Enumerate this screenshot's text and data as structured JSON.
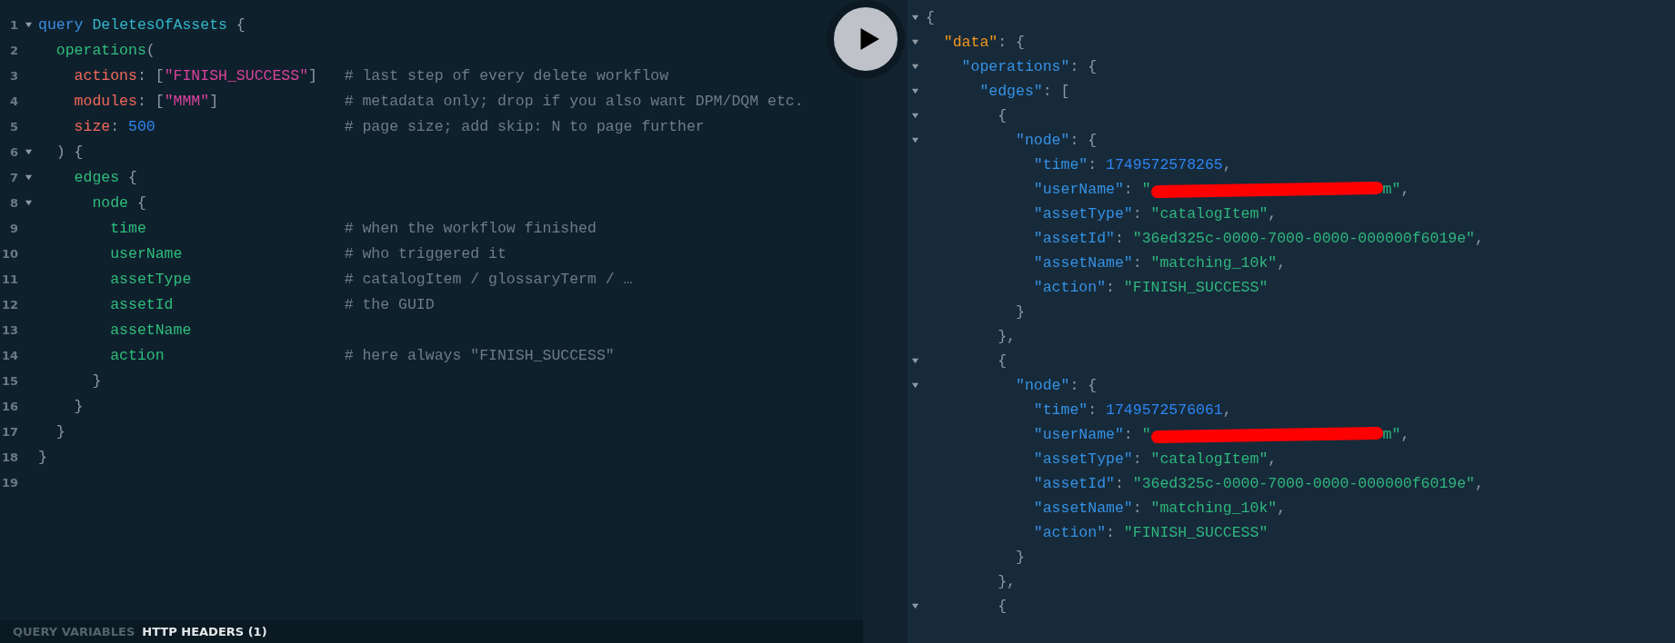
{
  "editor": {
    "lines": [
      {
        "number": "1",
        "foldable": true,
        "code": [
          {
            "kind": "keyword",
            "text": "query "
          },
          {
            "kind": "name",
            "text": "DeletesOfAssets"
          },
          {
            "kind": "punct",
            "text": " {"
          }
        ]
      },
      {
        "number": "2",
        "foldable": false,
        "code": [
          {
            "kind": "field",
            "text": "  operations"
          },
          {
            "kind": "punct",
            "text": "("
          }
        ]
      },
      {
        "number": "3",
        "foldable": false,
        "code": [
          {
            "kind": "arg",
            "text": "    actions"
          },
          {
            "kind": "punct",
            "text": ": ["
          },
          {
            "kind": "string",
            "text": "\"FINISH_SUCCESS\""
          },
          {
            "kind": "punct",
            "text": "]"
          }
        ],
        "comment": "# last step of every delete workflow"
      },
      {
        "number": "4",
        "foldable": false,
        "code": [
          {
            "kind": "arg",
            "text": "    modules"
          },
          {
            "kind": "punct",
            "text": ": ["
          },
          {
            "kind": "string",
            "text": "\"MMM\""
          },
          {
            "kind": "punct",
            "text": "]"
          }
        ],
        "comment": "# metadata only; drop if you also want DPM/DQM etc."
      },
      {
        "number": "5",
        "foldable": false,
        "code": [
          {
            "kind": "arg",
            "text": "    size"
          },
          {
            "kind": "punct",
            "text": ": "
          },
          {
            "kind": "number",
            "text": "500"
          }
        ],
        "comment": "# page size; add skip: N to page further"
      },
      {
        "number": "6",
        "foldable": true,
        "code": [
          {
            "kind": "punct",
            "text": "  ) {"
          }
        ]
      },
      {
        "number": "7",
        "foldable": true,
        "code": [
          {
            "kind": "field",
            "text": "    edges"
          },
          {
            "kind": "punct",
            "text": " {"
          }
        ]
      },
      {
        "number": "8",
        "foldable": true,
        "code": [
          {
            "kind": "field",
            "text": "      node"
          },
          {
            "kind": "punct",
            "text": " {"
          }
        ]
      },
      {
        "number": "9",
        "foldable": false,
        "code": [
          {
            "kind": "field",
            "text": "        time"
          }
        ],
        "comment": "# when the workflow finished"
      },
      {
        "number": "10",
        "foldable": false,
        "code": [
          {
            "kind": "field",
            "text": "        userName"
          }
        ],
        "comment": "# who triggered it"
      },
      {
        "number": "11",
        "foldable": false,
        "code": [
          {
            "kind": "field",
            "text": "        assetType"
          }
        ],
        "comment": "# catalogItem / glossaryTerm / …"
      },
      {
        "number": "12",
        "foldable": false,
        "code": [
          {
            "kind": "field",
            "text": "        assetId"
          }
        ],
        "comment": "# the GUID"
      },
      {
        "number": "13",
        "foldable": false,
        "code": [
          {
            "kind": "field",
            "text": "        assetName"
          }
        ]
      },
      {
        "number": "14",
        "foldable": false,
        "code": [
          {
            "kind": "field",
            "text": "        action"
          }
        ],
        "comment": "# here always \"FINISH_SUCCESS\""
      },
      {
        "number": "15",
        "foldable": false,
        "code": [
          {
            "kind": "punct",
            "text": "      }"
          }
        ]
      },
      {
        "number": "16",
        "foldable": false,
        "code": [
          {
            "kind": "punct",
            "text": "    }"
          }
        ]
      },
      {
        "number": "17",
        "foldable": false,
        "code": [
          {
            "kind": "punct",
            "text": "  }"
          }
        ]
      },
      {
        "number": "18",
        "foldable": false,
        "code": [
          {
            "kind": "punct",
            "text": "}"
          }
        ]
      },
      {
        "number": "19",
        "foldable": false
      }
    ]
  },
  "bottom_tabs": [
    {
      "label": "QUERY VARIABLES",
      "selected": false
    },
    {
      "label": "HTTP HEADERS (1)",
      "selected": true
    }
  ],
  "result": {
    "lines": [
      {
        "foldable": true,
        "code": [
          {
            "kind": "punct",
            "text": "{"
          }
        ]
      },
      {
        "foldable": true,
        "code": [
          {
            "kind": "toplevel",
            "text": "  \"data\""
          },
          {
            "kind": "punct",
            "text": ": {"
          }
        ]
      },
      {
        "foldable": true,
        "code": [
          {
            "kind": "key",
            "text": "    \"operations\""
          },
          {
            "kind": "punct",
            "text": ": {"
          }
        ]
      },
      {
        "foldable": true,
        "code": [
          {
            "kind": "key",
            "text": "      \"edges\""
          },
          {
            "kind": "punct",
            "text": ": ["
          }
        ]
      },
      {
        "foldable": true,
        "code": [
          {
            "kind": "punct",
            "text": "        {"
          }
        ]
      },
      {
        "foldable": true,
        "code": [
          {
            "kind": "key",
            "text": "          \"node\""
          },
          {
            "kind": "punct",
            "text": ": {"
          }
        ]
      },
      {
        "foldable": false,
        "code": [
          {
            "kind": "key",
            "text": "            \"time\""
          },
          {
            "kind": "punct",
            "text": ": "
          },
          {
            "kind": "number",
            "text": "1749572578265"
          },
          {
            "kind": "punct",
            "text": ","
          }
        ]
      },
      {
        "foldable": false,
        "code": [
          {
            "kind": "key",
            "text": "            \"userName\""
          },
          {
            "kind": "punct",
            "text": ": "
          },
          {
            "kind": "string",
            "text": "\""
          },
          {
            "kind": "redaction"
          },
          {
            "kind": "string",
            "text": "m\""
          },
          {
            "kind": "punct",
            "text": ","
          }
        ]
      },
      {
        "foldable": false,
        "code": [
          {
            "kind": "key",
            "text": "            \"assetType\""
          },
          {
            "kind": "punct",
            "text": ": "
          },
          {
            "kind": "string",
            "text": "\"catalogItem\""
          },
          {
            "kind": "punct",
            "text": ","
          }
        ]
      },
      {
        "foldable": false,
        "code": [
          {
            "kind": "key",
            "text": "            \"assetId\""
          },
          {
            "kind": "punct",
            "text": ": "
          },
          {
            "kind": "string",
            "text": "\"36ed325c-0000-7000-0000-000000f6019e\""
          },
          {
            "kind": "punct",
            "text": ","
          }
        ]
      },
      {
        "foldable": false,
        "code": [
          {
            "kind": "key",
            "text": "            \"assetName\""
          },
          {
            "kind": "punct",
            "text": ": "
          },
          {
            "kind": "string",
            "text": "\"matching_10k\""
          },
          {
            "kind": "punct",
            "text": ","
          }
        ]
      },
      {
        "foldable": false,
        "code": [
          {
            "kind": "key",
            "text": "            \"action\""
          },
          {
            "kind": "punct",
            "text": ": "
          },
          {
            "kind": "string",
            "text": "\"FINISH_SUCCESS\""
          }
        ]
      },
      {
        "foldable": false,
        "code": [
          {
            "kind": "punct",
            "text": "          }"
          }
        ]
      },
      {
        "foldable": false,
        "code": [
          {
            "kind": "punct",
            "text": "        },"
          }
        ]
      },
      {
        "foldable": true,
        "code": [
          {
            "kind": "punct",
            "text": "        {"
          }
        ]
      },
      {
        "foldable": true,
        "code": [
          {
            "kind": "key",
            "text": "          \"node\""
          },
          {
            "kind": "punct",
            "text": ": {"
          }
        ]
      },
      {
        "foldable": false,
        "code": [
          {
            "kind": "key",
            "text": "            \"time\""
          },
          {
            "kind": "punct",
            "text": ": "
          },
          {
            "kind": "number",
            "text": "1749572576061"
          },
          {
            "kind": "punct",
            "text": ","
          }
        ]
      },
      {
        "foldable": false,
        "code": [
          {
            "kind": "key",
            "text": "            \"userName\""
          },
          {
            "kind": "punct",
            "text": ": "
          },
          {
            "kind": "string",
            "text": "\""
          },
          {
            "kind": "redaction"
          },
          {
            "kind": "string",
            "text": "m\""
          },
          {
            "kind": "punct",
            "text": ","
          }
        ]
      },
      {
        "foldable": false,
        "code": [
          {
            "kind": "key",
            "text": "            \"assetType\""
          },
          {
            "kind": "punct",
            "text": ": "
          },
          {
            "kind": "string",
            "text": "\"catalogItem\""
          },
          {
            "kind": "punct",
            "text": ","
          }
        ]
      },
      {
        "foldable": false,
        "code": [
          {
            "kind": "key",
            "text": "            \"assetId\""
          },
          {
            "kind": "punct",
            "text": ": "
          },
          {
            "kind": "string",
            "text": "\"36ed325c-0000-7000-0000-000000f6019e\""
          },
          {
            "kind": "punct",
            "text": ","
          }
        ]
      },
      {
        "foldable": false,
        "code": [
          {
            "kind": "key",
            "text": "            \"assetName\""
          },
          {
            "kind": "punct",
            "text": ": "
          },
          {
            "kind": "string",
            "text": "\"matching_10k\""
          },
          {
            "kind": "punct",
            "text": ","
          }
        ]
      },
      {
        "foldable": false,
        "code": [
          {
            "kind": "key",
            "text": "            \"action\""
          },
          {
            "kind": "punct",
            "text": ": "
          },
          {
            "kind": "string",
            "text": "\"FINISH_SUCCESS\""
          }
        ]
      },
      {
        "foldable": false,
        "code": [
          {
            "kind": "punct",
            "text": "          }"
          }
        ]
      },
      {
        "foldable": false,
        "code": [
          {
            "kind": "punct",
            "text": "        },"
          }
        ]
      },
      {
        "foldable": true,
        "code": [
          {
            "kind": "punct",
            "text": "        {"
          }
        ]
      }
    ]
  }
}
